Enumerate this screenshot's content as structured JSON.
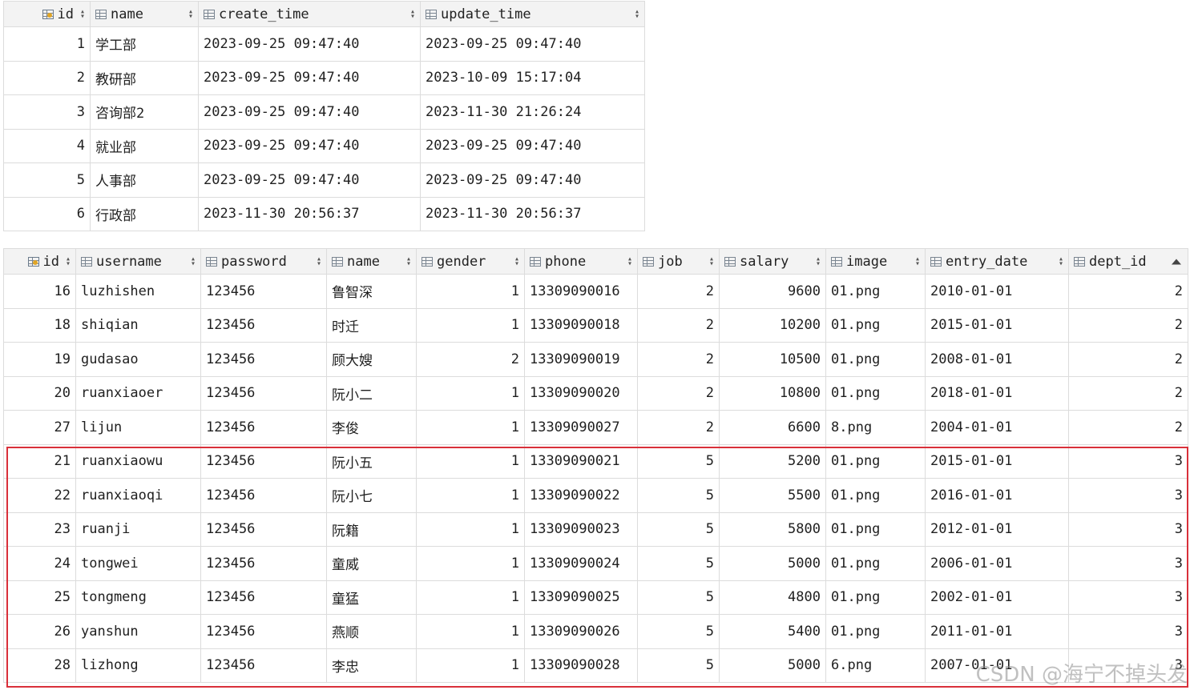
{
  "dept_table": {
    "columns": [
      "id",
      "name",
      "create_time",
      "update_time"
    ],
    "rows": [
      [
        "1",
        "学工部",
        "2023-09-25 09:47:40",
        "2023-09-25 09:47:40"
      ],
      [
        "2",
        "教研部",
        "2023-09-25 09:47:40",
        "2023-10-09 15:17:04"
      ],
      [
        "3",
        "咨询部2",
        "2023-09-25 09:47:40",
        "2023-11-30 21:26:24"
      ],
      [
        "4",
        "就业部",
        "2023-09-25 09:47:40",
        "2023-09-25 09:47:40"
      ],
      [
        "5",
        "人事部",
        "2023-09-25 09:47:40",
        "2023-09-25 09:47:40"
      ],
      [
        "6",
        "行政部",
        "2023-11-30 20:56:37",
        "2023-11-30 20:56:37"
      ]
    ]
  },
  "emp_table": {
    "columns": [
      "id",
      "username",
      "password",
      "name",
      "gender",
      "phone",
      "job",
      "salary",
      "image",
      "entry_date",
      "dept_id"
    ],
    "sorted_column": "dept_id",
    "rows": [
      [
        "16",
        "luzhishen",
        "123456",
        "鲁智深",
        "1",
        "13309090016",
        "2",
        "9600",
        "01.png",
        "2010-01-01",
        "2"
      ],
      [
        "18",
        "shiqian",
        "123456",
        "时迁",
        "1",
        "13309090018",
        "2",
        "10200",
        "01.png",
        "2015-01-01",
        "2"
      ],
      [
        "19",
        "gudasao",
        "123456",
        "顾大嫂",
        "2",
        "13309090019",
        "2",
        "10500",
        "01.png",
        "2008-01-01",
        "2"
      ],
      [
        "20",
        "ruanxiaoer",
        "123456",
        "阮小二",
        "1",
        "13309090020",
        "2",
        "10800",
        "01.png",
        "2018-01-01",
        "2"
      ],
      [
        "27",
        "lijun",
        "123456",
        "李俊",
        "1",
        "13309090027",
        "2",
        "6600",
        "8.png",
        "2004-01-01",
        "2"
      ],
      [
        "21",
        "ruanxiaowu",
        "123456",
        "阮小五",
        "1",
        "13309090021",
        "5",
        "5200",
        "01.png",
        "2015-01-01",
        "3"
      ],
      [
        "22",
        "ruanxiaoqi",
        "123456",
        "阮小七",
        "1",
        "13309090022",
        "5",
        "5500",
        "01.png",
        "2016-01-01",
        "3"
      ],
      [
        "23",
        "ruanji",
        "123456",
        "阮籍",
        "1",
        "13309090023",
        "5",
        "5800",
        "01.png",
        "2012-01-01",
        "3"
      ],
      [
        "24",
        "tongwei",
        "123456",
        "童威",
        "1",
        "13309090024",
        "5",
        "5000",
        "01.png",
        "2006-01-01",
        "3"
      ],
      [
        "25",
        "tongmeng",
        "123456",
        "童猛",
        "1",
        "13309090025",
        "5",
        "4800",
        "01.png",
        "2002-01-01",
        "3"
      ],
      [
        "26",
        "yanshun",
        "123456",
        "燕顺",
        "1",
        "13309090026",
        "5",
        "5400",
        "01.png",
        "2011-01-01",
        "3"
      ],
      [
        "28",
        "lizhong",
        "123456",
        "李忠",
        "1",
        "13309090028",
        "5",
        "5000",
        "6.png",
        "2007-01-01",
        "3"
      ]
    ]
  },
  "watermark": "CSDN @海宁不掉头发",
  "colors": {
    "highlight_border": "#d9303a",
    "header_bg": "#f3f3f3",
    "grid_line": "#dcdcdc",
    "key_icon": "#e0a526"
  }
}
